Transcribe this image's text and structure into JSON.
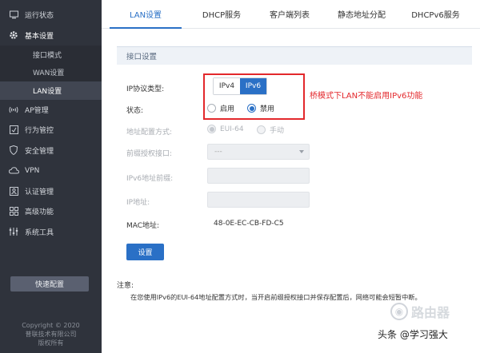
{
  "sidebar": {
    "items": [
      {
        "label": "运行状态",
        "icon": "monitor-icon"
      },
      {
        "label": "基本设置",
        "icon": "gear-icon"
      },
      {
        "label": "接口模式"
      },
      {
        "label": "WAN设置"
      },
      {
        "label": "LAN设置"
      },
      {
        "label": "AP管理",
        "icon": "signal-icon"
      },
      {
        "label": "行为管控",
        "icon": "behavior-icon"
      },
      {
        "label": "安全管理",
        "icon": "shield-icon"
      },
      {
        "label": "VPN",
        "icon": "cloud-icon"
      },
      {
        "label": "认证管理",
        "icon": "auth-icon"
      },
      {
        "label": "高级功能",
        "icon": "grid-icon"
      },
      {
        "label": "系统工具",
        "icon": "tools-icon"
      }
    ],
    "quick_config": "快速配置",
    "copyright": [
      "Copyright © 2020",
      "普联技术有限公司",
      "版权所有"
    ]
  },
  "tabs": [
    {
      "label": "LAN设置"
    },
    {
      "label": "DHCP服务"
    },
    {
      "label": "客户端列表"
    },
    {
      "label": "静态地址分配"
    },
    {
      "label": "DHCPv6服务"
    }
  ],
  "section": {
    "title": "接口设置"
  },
  "form": {
    "ip_type_label": "IP协议类型:",
    "ipv4": "IPv4",
    "ipv6": "IPv6",
    "status_label": "状态:",
    "enable": "启用",
    "disable": "禁用",
    "addr_mode_label": "地址配置方式:",
    "eui64": "EUI-64",
    "manual": "手动",
    "prefix_iface_label": "前缀授权接口:",
    "prefix_iface_value": "---",
    "prefix_label": "IPv6地址前缀:",
    "ip_label": "IP地址:",
    "mac_label": "MAC地址:",
    "mac_value": "48-0E-EC-CB-FD-C5",
    "save": "设置"
  },
  "annotation": "桥模式下LAN不能启用IPv6功能",
  "note": {
    "title": "注意:",
    "text": "在您使用IPv6的EUI-64地址配置方式时，当开启前缀授权接口并保存配置后，网络可能会短暂中断。"
  },
  "watermark": {
    "logo_text": "路由器",
    "caption": "头条 @学习强大"
  },
  "colors": {
    "accent": "#2a70c6",
    "sidebar_bg": "#2f333c",
    "annotation_red": "#e3282c"
  }
}
